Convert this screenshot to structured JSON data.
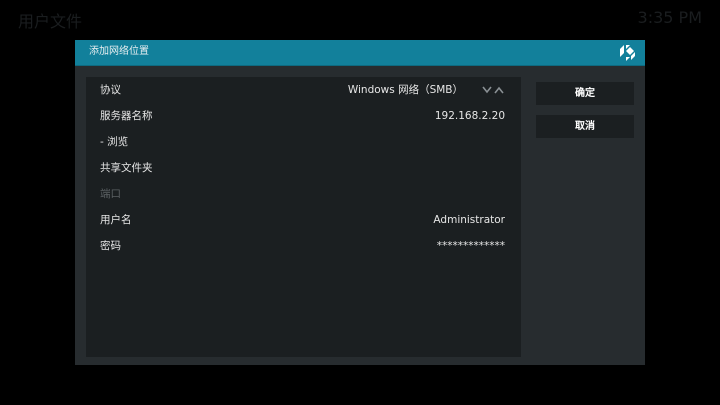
{
  "background": {
    "left_text": "用户文件",
    "right_text": "3:35 PM"
  },
  "dialog": {
    "title": "添加网络位置",
    "logo_icon": "kodi-logo-icon",
    "header_color": "#12809b",
    "rows": [
      {
        "label": "协议",
        "value": "Windows 网络（SMB）",
        "has_spinner": true,
        "enabled": true
      },
      {
        "label": "服务器名称",
        "value": "192.168.2.20",
        "enabled": true
      },
      {
        "label": "- 浏览",
        "value": "",
        "enabled": true
      },
      {
        "label": "共享文件夹",
        "value": "",
        "enabled": true
      },
      {
        "label": "端口",
        "value": "",
        "enabled": false
      },
      {
        "label": "用户名",
        "value": "Administrator",
        "enabled": true
      },
      {
        "label": "密码",
        "value": "*************",
        "enabled": true
      }
    ],
    "buttons": {
      "ok_label": "确定",
      "cancel_label": "取消"
    }
  }
}
